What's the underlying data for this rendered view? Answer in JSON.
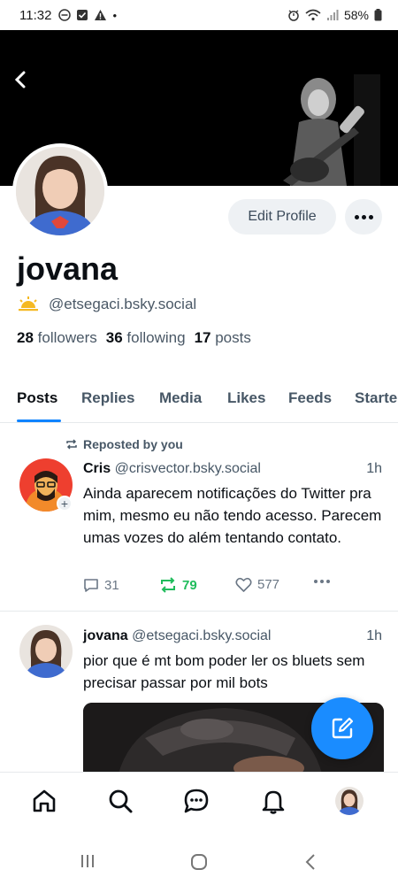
{
  "status_bar": {
    "time": "11:32",
    "battery": "58%"
  },
  "profile": {
    "display_name": "jovana",
    "handle": "@etsegaci.bsky.social",
    "followers_count": "28",
    "followers_label": "followers",
    "following_count": "36",
    "following_label": "following",
    "posts_count": "17",
    "posts_label": "posts",
    "edit_label": "Edit Profile"
  },
  "tabs": [
    {
      "label": "Posts"
    },
    {
      "label": "Replies"
    },
    {
      "label": "Media"
    },
    {
      "label": "Likes"
    },
    {
      "label": "Feeds"
    },
    {
      "label": "Starte"
    }
  ],
  "feed": [
    {
      "repost_label": "Reposted by you",
      "author": "Cris",
      "handle": "@crisvector.bsky.social",
      "time": "1h",
      "text": "Ainda aparecem notificações do Twitter pra mim, mesmo eu não tendo acesso. Parecem umas vozes do além tentando contato.",
      "replies": "31",
      "reposts": "79",
      "likes": "577"
    },
    {
      "author": "jovana",
      "handle": "@etsegaci.bsky.social",
      "time": "1h",
      "text": "pior que é mt bom poder ler os bluets sem precisar passar por mil bots"
    }
  ],
  "colors": {
    "accent": "#1083fe",
    "repost_green": "#20bc5c",
    "fab": "#1a8cff"
  },
  "icons": [
    "back-icon",
    "more-icon",
    "repost-icon",
    "reply-icon",
    "like-icon",
    "compose-icon",
    "home-icon",
    "search-icon",
    "chat-icon",
    "bell-icon"
  ]
}
